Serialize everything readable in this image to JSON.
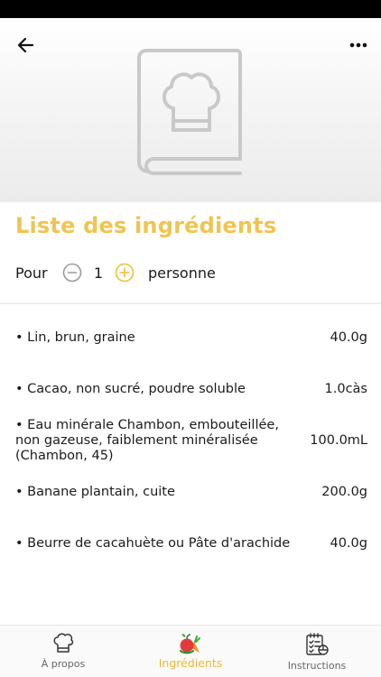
{
  "header": {
    "back_icon": "arrow-left-icon",
    "menu_icon": "more-dots-icon",
    "hero_icon": "cookbook-chef-hat-icon"
  },
  "section": {
    "title": "Liste des ingrédients"
  },
  "servings": {
    "prefix": "Pour",
    "count": "1",
    "suffix": "personne"
  },
  "ingredients": [
    {
      "name": "• Lin, brun, graine",
      "quantity": "40.0g"
    },
    {
      "name": "• Cacao, non sucré, poudre soluble",
      "quantity": "1.0càs"
    },
    {
      "name": "• Eau minérale Chambon, embouteillée, non gazeuse, faiblement minéralisée (Chambon, 45)",
      "quantity": "100.0mL"
    },
    {
      "name": "• Banane plantain, cuite",
      "quantity": "200.0g"
    },
    {
      "name": "• Beurre de cacahuète ou Pâte d'arachide",
      "quantity": "40.0g"
    }
  ],
  "tabs": [
    {
      "label": "À propos",
      "icon": "chef-hat-icon"
    },
    {
      "label": "Ingrédients",
      "icon": "vegetables-icon",
      "active": true
    },
    {
      "label": "Instructions",
      "icon": "checklist-icon"
    }
  ],
  "colors": {
    "accent": "#f0c451",
    "tab_active": "#f0b82e"
  }
}
